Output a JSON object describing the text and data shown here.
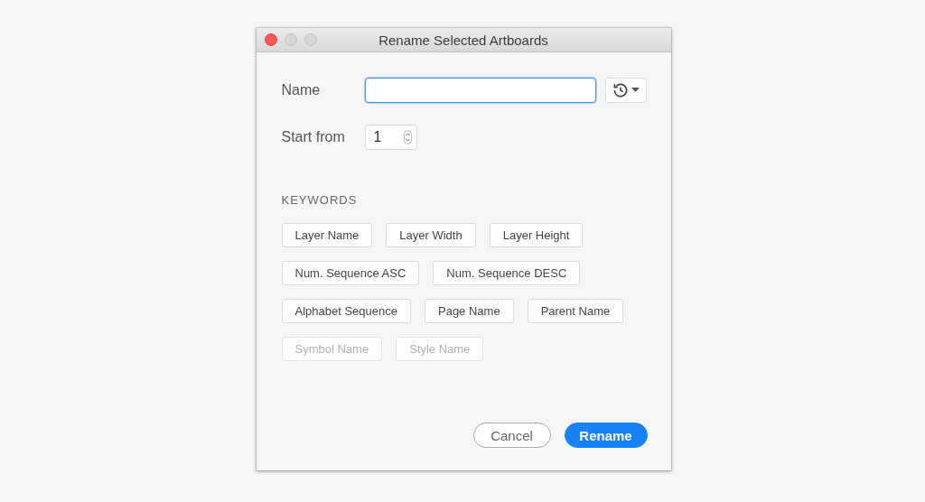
{
  "window": {
    "title": "Rename Selected Artboards"
  },
  "name_field": {
    "label": "Name"
  },
  "start_from": {
    "label": "Start from",
    "value": "1"
  },
  "keywords": {
    "heading": "KEYWORDS",
    "rows": [
      [
        {
          "label": "Layer Name",
          "disabled": false
        },
        {
          "label": "Layer Width",
          "disabled": false
        },
        {
          "label": "Layer Height",
          "disabled": false
        }
      ],
      [
        {
          "label": "Num. Sequence ASC",
          "disabled": false
        },
        {
          "label": "Num. Sequence DESC",
          "disabled": false
        }
      ],
      [
        {
          "label": "Alphabet Sequence",
          "disabled": false
        },
        {
          "label": "Page Name",
          "disabled": false
        },
        {
          "label": "Parent Name",
          "disabled": false
        }
      ],
      [
        {
          "label": "Symbol Name",
          "disabled": true
        },
        {
          "label": "Style Name",
          "disabled": true
        }
      ]
    ]
  },
  "buttons": [
    {
      "label": "Cancel",
      "kind": "secondary"
    },
    {
      "label": "Rename",
      "kind": "primary"
    }
  ]
}
